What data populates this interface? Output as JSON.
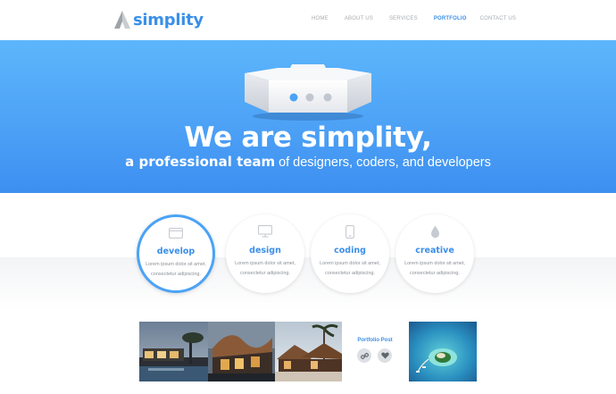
{
  "header": {
    "logo_text": "simplity",
    "nav": [
      {
        "label": "HOME",
        "active": false
      },
      {
        "label": "ABOUT US",
        "active": false
      },
      {
        "label": "SERVICES",
        "active": false
      },
      {
        "label": "PORTFOLIO",
        "active": true
      },
      {
        "label": "CONTACT US",
        "active": false
      }
    ]
  },
  "hero": {
    "title": "We are simplity,",
    "subtitle_bold": "a professional team",
    "subtitle_rest": "of designers, coders, and developers"
  },
  "services": [
    {
      "title": "develop",
      "body": "Lorem ipsum dolor sit amet, consectetur adipiscing.",
      "icon": "browser-window-icon",
      "active": true
    },
    {
      "title": "design",
      "body": "Lorem ipsum dolor sit amet, consectetur adipiscing.",
      "icon": "monitor-icon",
      "active": false
    },
    {
      "title": "coding",
      "body": "Lorem ipsum dolor sit amet, consectetur adipiscing.",
      "icon": "smartphone-icon",
      "active": false
    },
    {
      "title": "creative",
      "body": "Lorem ipsum dolor sit amet, consectetur adipiscing.",
      "icon": "drop-icon",
      "active": false
    }
  ],
  "portfolio": {
    "post_label": "Portfolio Post",
    "buttons": [
      "link-icon",
      "heart-icon"
    ]
  },
  "colors": {
    "accent": "#3b8fe8",
    "hero_top": "#5db6fb",
    "hero_bottom": "#3d8ff0",
    "nav_text": "#a7acb2"
  }
}
